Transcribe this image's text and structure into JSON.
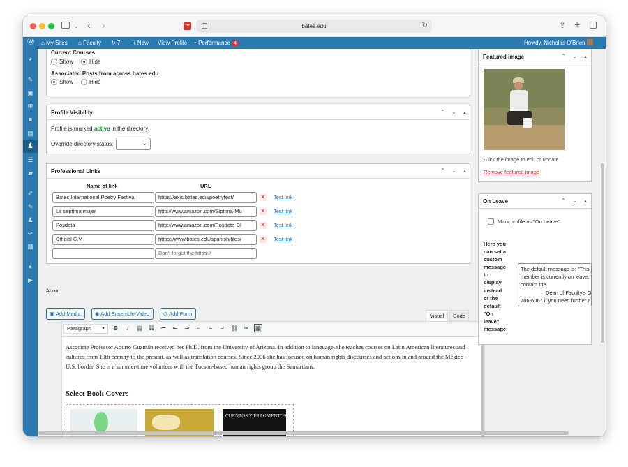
{
  "browser": {
    "url": "bates.edu"
  },
  "adminbar": {
    "my_sites": "My Sites",
    "faculty": "Faculty",
    "updates": "7",
    "new": "New",
    "view_profile": "View Profile",
    "performance": "Performance",
    "performance_badge": "4",
    "howdy": "Howdy, Nicholas O'Brien"
  },
  "profile_options": {
    "current_courses_label": "Current Courses",
    "show": "Show",
    "hide": "Hide",
    "current_courses_selected": "Hide",
    "associated_posts_label": "Associated Posts from across bates.edu",
    "associated_posts_selected": "Show"
  },
  "visibility": {
    "title": "Profile Visibility",
    "status_prefix": "Profile is marked",
    "status_word": "active",
    "status_suffix": "in the directory.",
    "override_label": "Override directory status:",
    "override_value": ""
  },
  "links": {
    "title": "Professional Links",
    "col_name": "Name of link",
    "col_url": "URL",
    "rows": [
      {
        "name": "Bates International Poetry Festival",
        "url": "https://axis.bates.edu/poetryfest/",
        "test": "Test link"
      },
      {
        "name": "La septima mujer",
        "url": "http://www.amazon.com/Siptima-Mu",
        "test": "Test link"
      },
      {
        "name": "Posdata",
        "url": "http://www.amazon.com/Posdata-Cl",
        "test": "Test link"
      },
      {
        "name": "Official C.V.",
        "url": "https://www.bates.edu/spanish/files/",
        "test": "Test link"
      }
    ],
    "empty_name": "",
    "url_placeholder": "Don't forget the https://"
  },
  "about": {
    "label": "About",
    "add_media": "Add Media",
    "add_ensemble": "Add Ensemble Video",
    "add_form": "Add Form",
    "tab_visual": "Visual",
    "tab_code": "Code",
    "format_select": "Paragraph",
    "body": "Associate Professor Aburto Guzmán received her Ph.D. from the University of Arizona.  In addition to language, she teaches courses on Latin American literatures and cultures from 19th century to the present, as well as translation courses. Since 2006 she has focused on human rights discourses and actions in and around the México - U.S. border.  She is a summer-time volunteer with the Tucson-based human rights group the Samaritans.",
    "heading": "Select Book Covers",
    "cover3_title": "CUENTOS Y FRAGMENTOS"
  },
  "featured_image": {
    "title": "Featured image",
    "hint": "Click the image to edit or update",
    "remove": "Remove featured image"
  },
  "on_leave": {
    "title": "On Leave",
    "checkbox_label": "Mark profile as \"On Leave\"",
    "custom_label_lines": [
      "Here you",
      "can set a",
      "custom",
      "message",
      "to",
      "display",
      "instead",
      "of the",
      "default",
      "\"On",
      "leave\"",
      "message:"
    ],
    "default_message_lines": [
      "The default message is: \"This",
      "member is currently on leave.",
      "contact the",
      "Dean of Faculty's Off",
      "786-6067 if you need further a"
    ]
  },
  "colors": {
    "admin_blue": "#2a7ab0",
    "link": "#2271b1",
    "active_green": "#008a20",
    "delete_red": "#d63638",
    "badge_red": "#d63638"
  }
}
